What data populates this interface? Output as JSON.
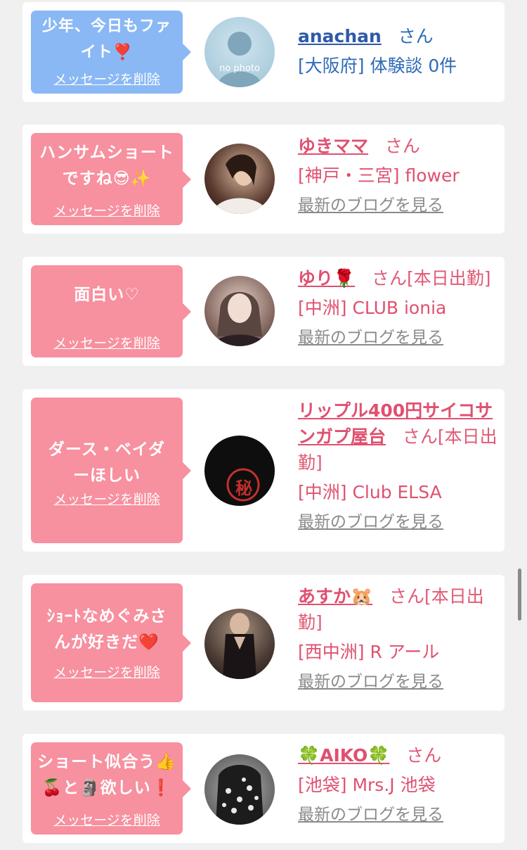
{
  "cards": [
    {
      "message": "少年、今日もファイト❣️",
      "delete_label": "メッセージを削除",
      "name": "anachan",
      "honorific": "さん",
      "shop": "[大阪府] 体験談 0件",
      "blog_label": "",
      "avatar_text": "no photo",
      "theme": "blue"
    },
    {
      "message": "ハンサムショートですね😎✨",
      "delete_label": "メッセージを削除",
      "name": "ゆきママ",
      "honorific": "さん",
      "shop": "[神戸・三宮] flower",
      "blog_label": "最新のブログを見る",
      "theme": "pink"
    },
    {
      "message": "面白い♡",
      "delete_label": "メッセージを削除",
      "name": "ゆり🌹",
      "honorific": "さん[本日出勤]",
      "shop": "[中洲] CLUB ionia",
      "blog_label": "最新のブログを見る",
      "theme": "pink"
    },
    {
      "message": "ダース・ベイダーほしい",
      "delete_label": "メッセージを削除",
      "name": "リップル400円サイコサンガプ屋台",
      "honorific": "さん[本日出勤]",
      "shop": "[中洲] Club ELSA",
      "blog_label": "最新のブログを見る",
      "avatar_text": "秘",
      "theme": "pink"
    },
    {
      "message": "ｼｮｰﾄなめぐみさんが好きだ❤️",
      "delete_label": "メッセージを削除",
      "name": "あすか🐹",
      "honorific": "さん[本日出勤]",
      "shop": "[西中洲] R アール",
      "blog_label": "最新のブログを見る",
      "theme": "pink"
    },
    {
      "message": "ショート似合う👍🍒と🗿欲しい❗️",
      "delete_label": "メッセージを削除",
      "name": "🍀AIKO🍀",
      "honorific": "さん",
      "shop": "[池袋] Mrs.J 池袋",
      "blog_label": "最新のブログを見る",
      "theme": "pink"
    }
  ],
  "colors": {
    "bubble_blue": "#8ab8f5",
    "bubble_pink": "#f7909f",
    "name_pink": "#e0506f",
    "name_blue": "#2e5aa8"
  }
}
